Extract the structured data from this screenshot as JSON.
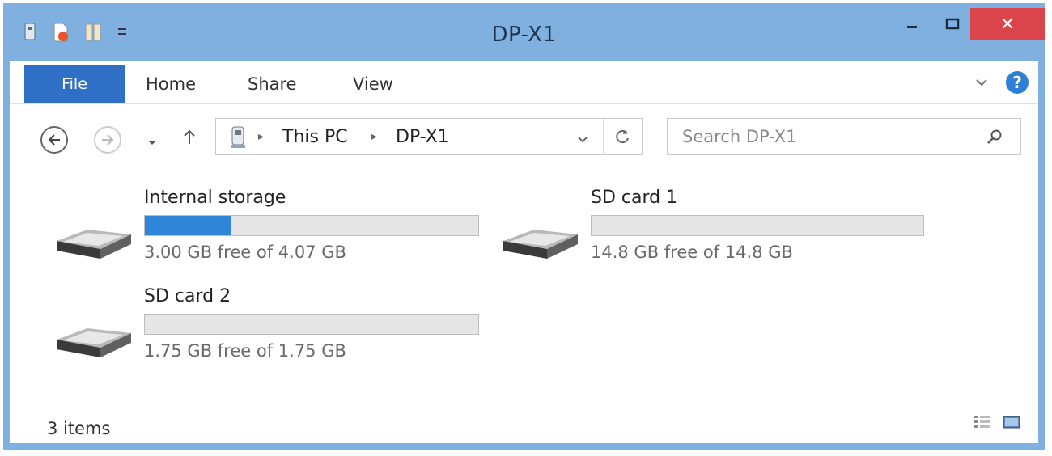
{
  "window": {
    "title": "DP-X1",
    "close_glyph": "✕",
    "minimize_glyph": "—",
    "maximize_glyph": "☐"
  },
  "ribbon": {
    "tabs": [
      {
        "label": "File"
      },
      {
        "label": "Home"
      },
      {
        "label": "Share"
      },
      {
        "label": "View"
      }
    ],
    "help_glyph": "?"
  },
  "nav": {
    "breadcrumb": [
      "This PC",
      "DP-X1"
    ],
    "search_placeholder": "Search DP-X1"
  },
  "drives": [
    {
      "name": "Internal storage",
      "free_text": "3.00 GB free of 4.07 GB",
      "used_fraction": 0.26
    },
    {
      "name": "SD card 1",
      "free_text": "14.8 GB free of 14.8 GB",
      "used_fraction": 0.0
    },
    {
      "name": "SD card 2",
      "free_text": "1.75 GB free of 1.75 GB",
      "used_fraction": 0.0
    }
  ],
  "status": {
    "item_count": "3 items"
  },
  "colors": {
    "titlebar": "#7fb0e0",
    "file_tab": "#2f6fc6",
    "close_button": "#d9454b",
    "usage_fill": "#2f86d8"
  }
}
